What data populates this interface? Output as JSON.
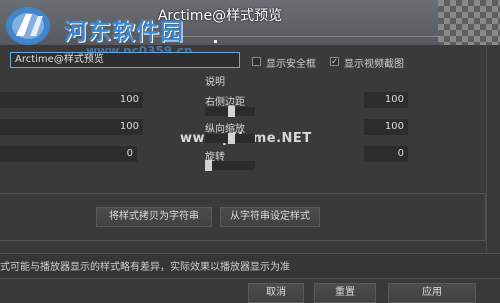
{
  "preview": {
    "title": "Arctime@样式预览"
  },
  "watermark": {
    "site_name": "河东软件园",
    "site_url": "www.pc0359.cn",
    "url2": "www.pHome.NET"
  },
  "toolbar": {
    "style_name_value": "Arctime@样式预览",
    "show_safe_frame_label": "显示安全框",
    "show_safe_frame_checked": false,
    "show_video_capture_label": "显示视频截图",
    "show_video_capture_checked": true
  },
  "fields": {
    "description_label": "说明",
    "right_margin_label": "右侧边距",
    "right_margin_value": "100",
    "right_margin_level": 0.53,
    "vertical_scale_label": "纵向缩放",
    "vertical_scale_value": "100",
    "vertical_scale_level": 0.53,
    "rotation_label": "旋转",
    "rotation_value": "0",
    "rotation_level": 0.0,
    "left_value_1": "100",
    "left_value_2": "100",
    "left_value_3": "0"
  },
  "buttons": {
    "copy_to_string": "将样式拷贝为字符串",
    "set_from_string": "从字符串设定样式",
    "cancel": "取消",
    "reset": "重置",
    "apply": "应用"
  },
  "note": "式可能与播放器显示的样式略有差异，实际效果以播放器显示为准",
  "colors": {
    "accent": "#6aa9df",
    "bg": "#3a3a3a",
    "watermark_blue": "#3c88d8"
  }
}
